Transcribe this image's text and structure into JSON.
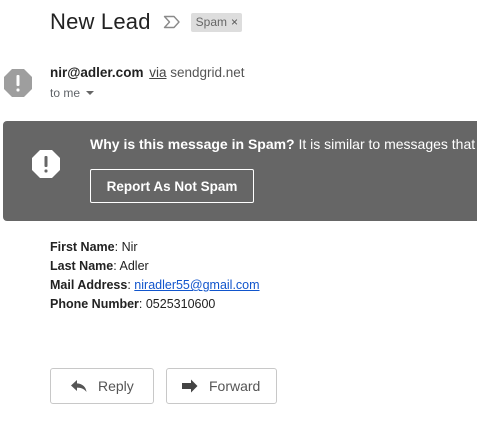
{
  "subject": {
    "title": "New Lead",
    "label_chip": "Spam",
    "chip_close": "×"
  },
  "sender": {
    "email": "nir@adler.com",
    "via_label": "via",
    "via_domain": "sendgrid.net",
    "to_label": "to me"
  },
  "spam_banner": {
    "question": "Why is this message in Spam?",
    "explanation": " It is similar to messages that",
    "button_label": "Report As Not Spam"
  },
  "message": {
    "fields": [
      {
        "label": "First Name",
        "sep": ": ",
        "value": "Nir"
      },
      {
        "label": "Last Name",
        "sep": ": ",
        "value": "Adler"
      },
      {
        "label": "Mail Address",
        "sep": ": ",
        "value": "niradler55@gmail.com"
      },
      {
        "label": "Phone Number",
        "sep": ": ",
        "value": "0525310600"
      }
    ]
  },
  "actions": {
    "reply_label": "Reply",
    "forward_label": "Forward"
  },
  "icons": {
    "importance": "importance-marker-icon",
    "avatar": "warning-avatar-icon",
    "banner": "spam-warning-icon",
    "reply": "reply-arrow-icon",
    "forward": "forward-arrow-icon",
    "caret": "caret-down-icon"
  },
  "colors": {
    "banner_background": "#666666",
    "link": "#1155cc",
    "chip_background": "#dddddd"
  }
}
